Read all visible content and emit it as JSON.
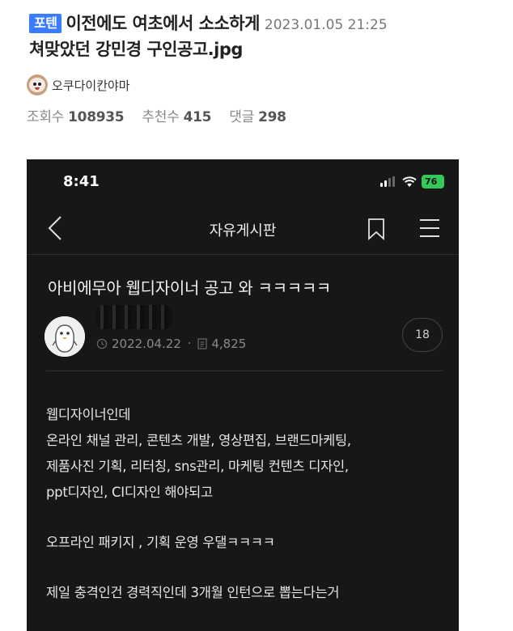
{
  "post": {
    "category": "포텐",
    "title_line1": "이전에도 여초에서 소소하게",
    "date": "2023.01.05 21:25",
    "title_line2": "쳐맞았던 강민경 구인공고.jpg",
    "author": "오쿠다이칸야마",
    "stats": {
      "views_label": "조회수",
      "views": "108935",
      "likes_label": "추천수",
      "likes": "415",
      "comments_label": "댓글",
      "comments": "298"
    }
  },
  "screenshot": {
    "status_time": "8:41",
    "battery": "76",
    "board_title": "자유게시판",
    "article_title": "아비에무아 웹디자이너 공고 와 ㅋㅋㅋㅋㅋ",
    "article_date": "2022.04.22",
    "article_views": "4,825",
    "comment_count": "18",
    "body": {
      "line1": "웹디자이너인데",
      "line2": "온라인 채널 관리, 콘텐츠 개발, 영상편집, 브랜드마케팅,",
      "line3": "제품사진 기획, 리터칭, sns관리, 마케팅 컨텐츠 디자인,",
      "line4": "ppt디자인, CI디자인 해야되고",
      "line5": "오프라인 패키지 , 기획 운영 우댈ㅋㅋㅋㅋ",
      "line6": "제일 충격인건 경력직인데 3개월 인턴으로 뽑는다는거"
    }
  },
  "icons": {
    "back": "chevron-left-icon",
    "bookmark": "bookmark-icon",
    "menu": "hamburger-menu-icon",
    "signal": "cellular-signal-icon",
    "wifi": "wifi-icon",
    "clock": "clock-icon",
    "views": "document-icon"
  },
  "colors": {
    "category_badge": "#3b7cff",
    "app_background": "#171717",
    "battery": "#34c759"
  }
}
